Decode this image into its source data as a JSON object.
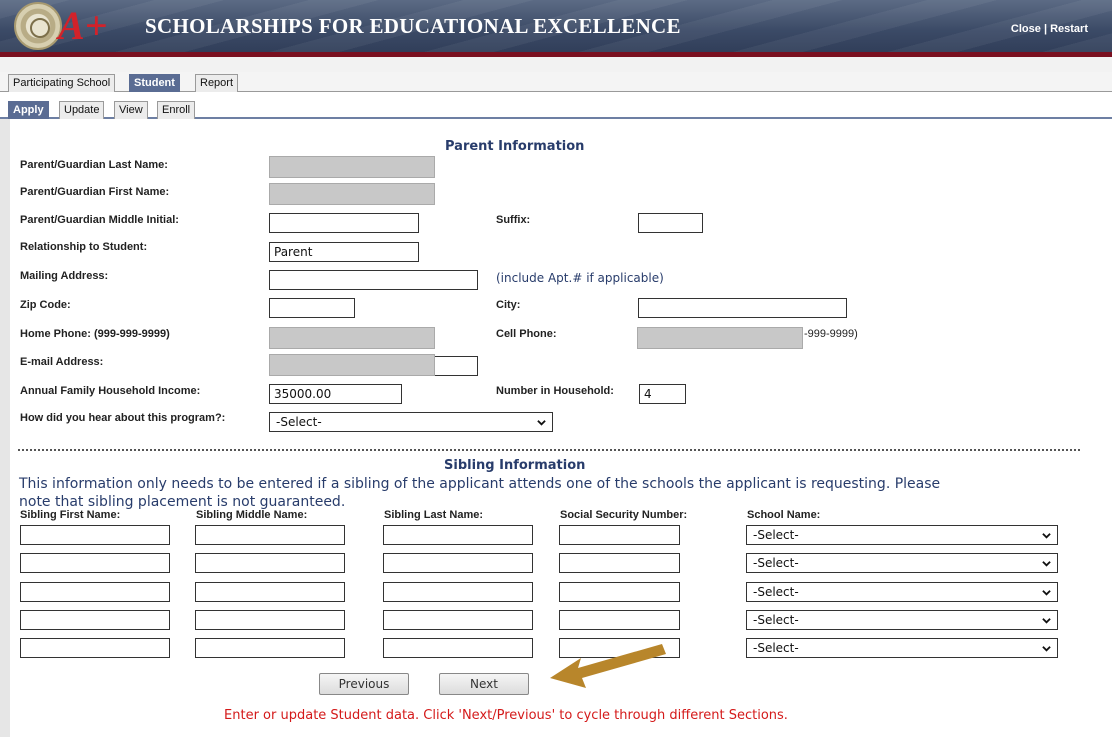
{
  "header": {
    "title": "SCHOLARSHIPS FOR EDUCATIONAL EXCELLENCE",
    "logo_text": "A+",
    "close_label": "Close",
    "separator": "|",
    "restart_label": "Restart",
    "accent_color": "#7a1020"
  },
  "tabs_primary": [
    "Participating School",
    "Student",
    "Report"
  ],
  "tabs_secondary": [
    "Apply",
    "Update",
    "View",
    "Enroll"
  ],
  "parent_section": {
    "title": "Parent Information",
    "labels": {
      "last_name": "Parent/Guardian Last Name:",
      "first_name": "Parent/Guardian First Name:",
      "middle_initial": "Parent/Guardian Middle Initial:",
      "suffix": "Suffix:",
      "relationship": "Relationship to Student:",
      "mailing_address": "Mailing Address:",
      "apt_hint": "(include Apt.# if applicable)",
      "zip": "Zip Code:",
      "city": "City:",
      "home_phone": "Home Phone: (999-999-9999)",
      "cell_phone": "Cell Phone:",
      "cell_phone_suffix": "-999-9999)",
      "email": "E-mail Address:",
      "income": "Annual Family Household Income:",
      "household": "Number in Household:",
      "hear_about": "How did you hear about this program?:"
    },
    "values": {
      "relationship": "Parent",
      "income": "35000.00",
      "household": "4",
      "hear_about": "-Select-"
    }
  },
  "sibling_section": {
    "title": "Sibling Information",
    "note_line1": "This information only needs to be entered if a sibling of the applicant attends one of the schools the applicant is requesting. Please",
    "note_line2": "note that sibling placement is not guaranteed.",
    "columns": [
      "Sibling First Name:",
      "Sibling Middle Name:",
      "Sibling Last Name:",
      "Social Security Number:",
      "School Name:"
    ],
    "school_select_values": [
      "-Select-",
      "-Select-",
      "-Select-",
      "-Select-",
      "-Select-"
    ]
  },
  "nav": {
    "previous_label": "Previous",
    "next_label": "Next"
  },
  "status_message": "Enter or update Student data. Click 'Next/Previous' to cycle through different Sections.",
  "annotation_arrow_color": "#b8862b"
}
